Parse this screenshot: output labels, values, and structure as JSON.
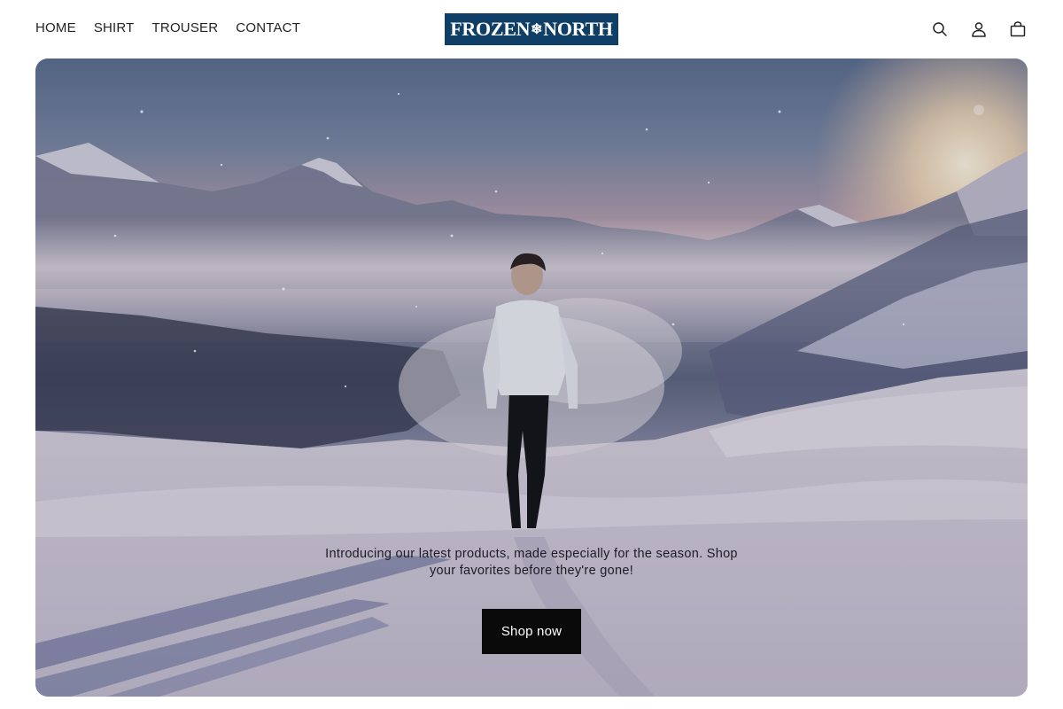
{
  "header": {
    "nav": [
      {
        "label": "HOME"
      },
      {
        "label": "SHIRT"
      },
      {
        "label": "TROUSER"
      },
      {
        "label": "CONTACT"
      }
    ],
    "logo": {
      "text_left": "FROZEN",
      "text_right": "NORTH",
      "color": "#0f3f66"
    },
    "icons": [
      "search-icon",
      "account-icon",
      "cart-icon"
    ]
  },
  "hero": {
    "description": "Introducing our latest products, made especially for the season. Shop your favorites before they're gone!",
    "cta_label": "Shop now"
  },
  "colors": {
    "button_bg": "#0a0a0a",
    "logo_bg": "#0f3f66"
  }
}
